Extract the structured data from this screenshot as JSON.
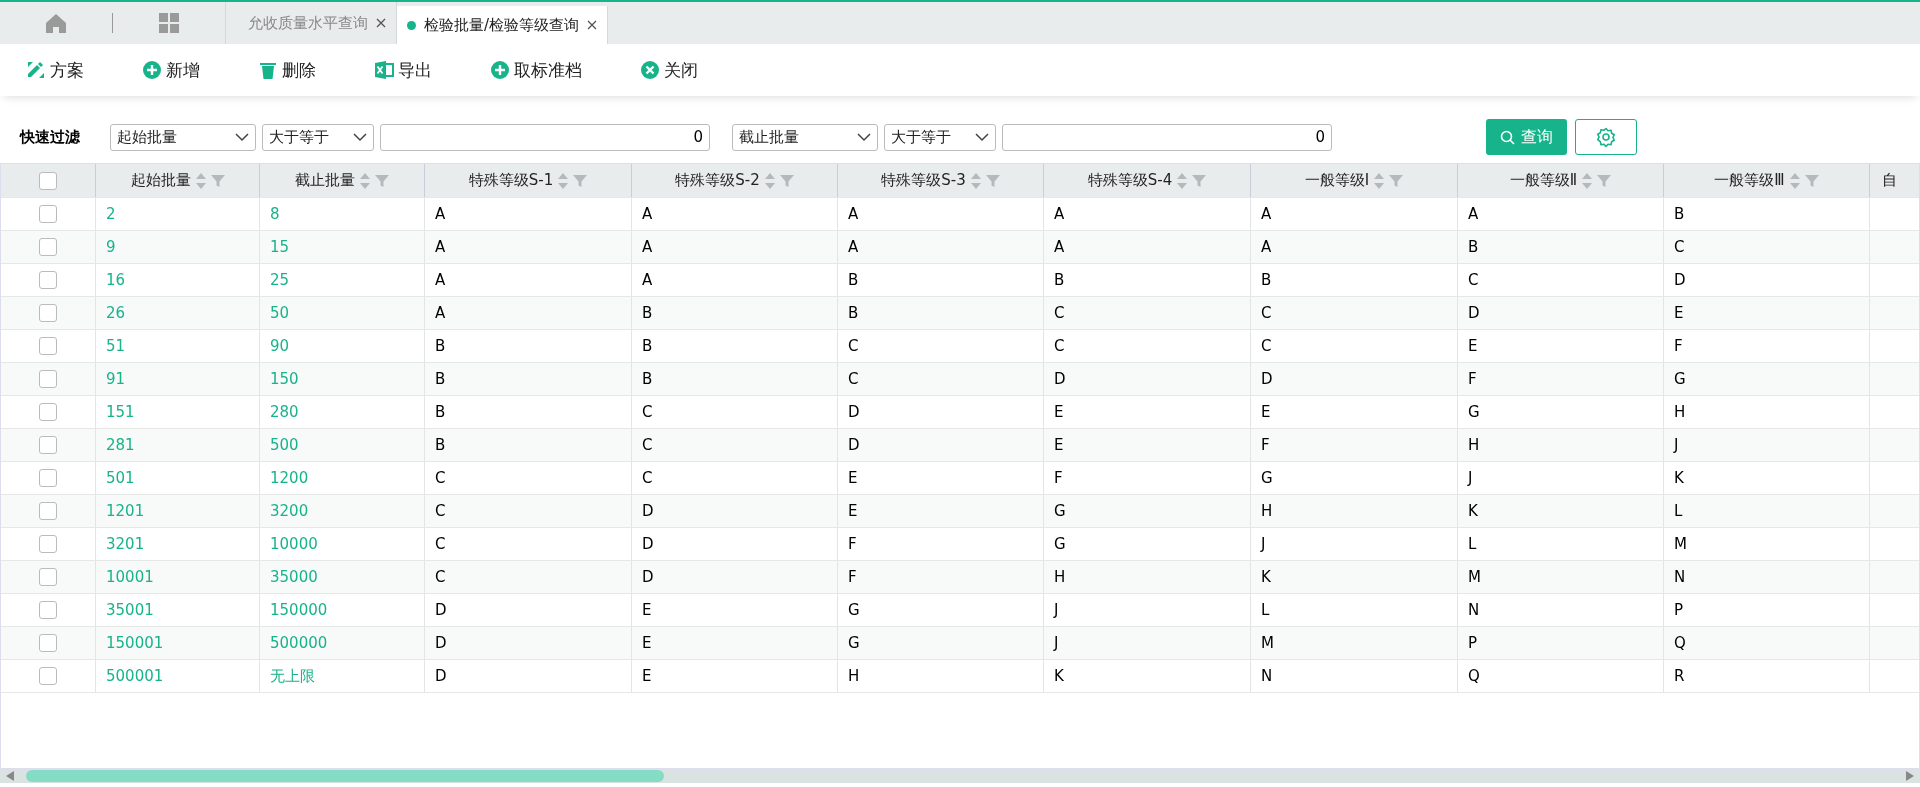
{
  "tabs": [
    {
      "label": "允收质量水平查询",
      "selected": false
    },
    {
      "label": "检验批量/检验等级查询",
      "selected": true
    }
  ],
  "toolbar": [
    {
      "kind": "scheme",
      "label": "方案"
    },
    {
      "kind": "add",
      "label": "新增"
    },
    {
      "kind": "delete",
      "label": "删除"
    },
    {
      "kind": "excel",
      "label": "导出"
    },
    {
      "kind": "add",
      "label": "取标准档"
    },
    {
      "kind": "close",
      "label": "关闭"
    }
  ],
  "filter": {
    "label": "快速过滤",
    "groups": [
      {
        "field": "起始批量",
        "operator": "大于等于",
        "value": "0"
      },
      {
        "field": "截止批量",
        "operator": "大于等于",
        "value": "0"
      }
    ],
    "query_button": "查询"
  },
  "table": {
    "select_all_checked": false,
    "columns": [
      {
        "label": "起始批量",
        "sortable": true
      },
      {
        "label": "截止批量",
        "sortable": true
      },
      {
        "label": "特殊等级S-1",
        "sortable": true
      },
      {
        "label": "特殊等级S-2",
        "sortable": true
      },
      {
        "label": "特殊等级S-3",
        "sortable": true
      },
      {
        "label": "特殊等级S-4",
        "sortable": true
      },
      {
        "label": "一般等级Ⅰ",
        "sortable": true
      },
      {
        "label": "一般等级Ⅱ",
        "sortable": true
      },
      {
        "label": "一般等级Ⅲ",
        "sortable": true
      },
      {
        "label": "自",
        "sortable": false
      }
    ],
    "rows": [
      {
        "checked": false,
        "cells": [
          "2",
          "8",
          "A",
          "A",
          "A",
          "A",
          "A",
          "A",
          "B"
        ]
      },
      {
        "checked": false,
        "cells": [
          "9",
          "15",
          "A",
          "A",
          "A",
          "A",
          "A",
          "B",
          "C"
        ]
      },
      {
        "checked": false,
        "cells": [
          "16",
          "25",
          "A",
          "A",
          "B",
          "B",
          "B",
          "C",
          "D"
        ]
      },
      {
        "checked": false,
        "cells": [
          "26",
          "50",
          "A",
          "B",
          "B",
          "C",
          "C",
          "D",
          "E"
        ]
      },
      {
        "checked": false,
        "cells": [
          "51",
          "90",
          "B",
          "B",
          "C",
          "C",
          "C",
          "E",
          "F"
        ]
      },
      {
        "checked": false,
        "cells": [
          "91",
          "150",
          "B",
          "B",
          "C",
          "D",
          "D",
          "F",
          "G"
        ]
      },
      {
        "checked": false,
        "cells": [
          "151",
          "280",
          "B",
          "C",
          "D",
          "E",
          "E",
          "G",
          "H"
        ]
      },
      {
        "checked": false,
        "cells": [
          "281",
          "500",
          "B",
          "C",
          "D",
          "E",
          "F",
          "H",
          "J"
        ]
      },
      {
        "checked": false,
        "cells": [
          "501",
          "1200",
          "C",
          "C",
          "E",
          "F",
          "G",
          "J",
          "K"
        ]
      },
      {
        "checked": false,
        "cells": [
          "1201",
          "3200",
          "C",
          "D",
          "E",
          "G",
          "H",
          "K",
          "L"
        ]
      },
      {
        "checked": false,
        "cells": [
          "3201",
          "10000",
          "C",
          "D",
          "F",
          "G",
          "J",
          "L",
          "M"
        ]
      },
      {
        "checked": false,
        "cells": [
          "10001",
          "35000",
          "C",
          "D",
          "F",
          "H",
          "K",
          "M",
          "N"
        ]
      },
      {
        "checked": false,
        "cells": [
          "35001",
          "150000",
          "D",
          "E",
          "G",
          "J",
          "L",
          "N",
          "P"
        ]
      },
      {
        "checked": false,
        "cells": [
          "150001",
          "500000",
          "D",
          "E",
          "G",
          "J",
          "M",
          "P",
          "Q"
        ]
      },
      {
        "checked": false,
        "cells": [
          "500001",
          "无上限",
          "D",
          "E",
          "H",
          "K",
          "N",
          "Q",
          "R"
        ]
      }
    ]
  }
}
